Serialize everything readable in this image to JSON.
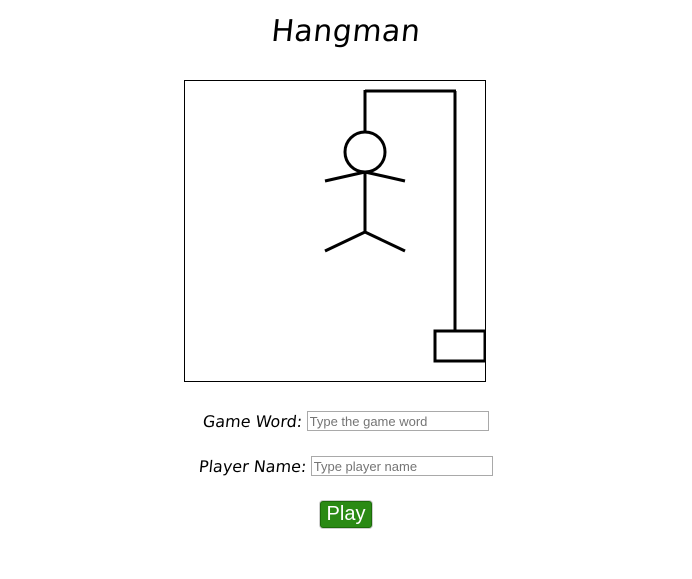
{
  "page": {
    "title": "Hangman"
  },
  "game": {
    "drawing": {
      "parts_shown": [
        "base",
        "pole",
        "beam",
        "rope",
        "head",
        "body",
        "arms",
        "legs"
      ],
      "stroke_color": "#000000"
    }
  },
  "form": {
    "game_word": {
      "label": "Game Word:",
      "value": "",
      "placeholder": "Type the game word"
    },
    "player_name": {
      "label": "Player Name:",
      "value": "",
      "placeholder": "Type player name"
    },
    "play_label": "Play"
  },
  "colors": {
    "play_button_bg": "#2a8a14",
    "play_button_text": "#ffffff",
    "border": "#000000"
  }
}
